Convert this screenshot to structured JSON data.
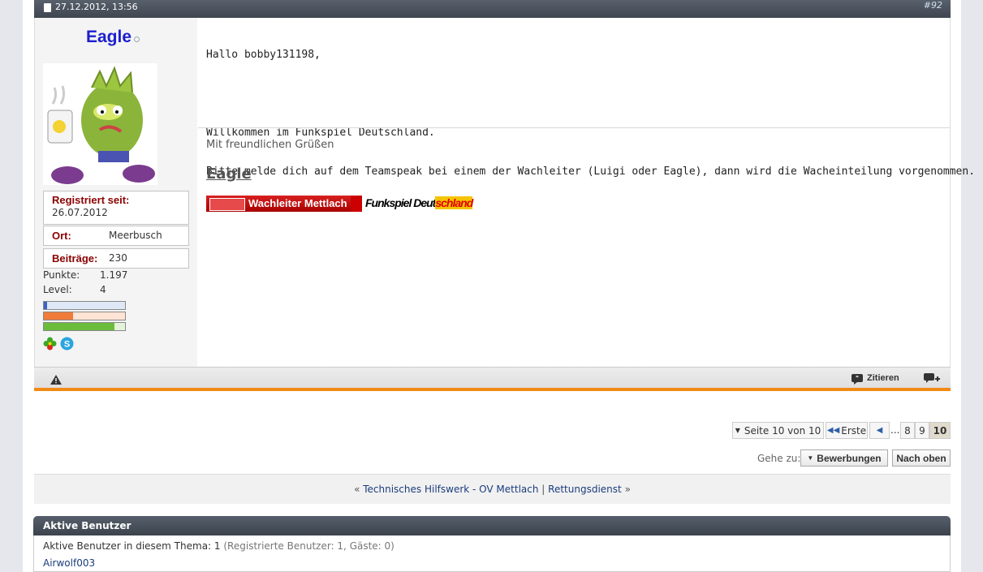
{
  "post": {
    "date": "27.12.2012, 13:56",
    "number": "#92",
    "author": "Eagle",
    "info": {
      "registered_label": "Registriert seit:",
      "registered_value": "26.07.2012",
      "location_label": "Ort:",
      "location_value": "Meerbusch",
      "posts_label": "Beiträge:",
      "posts_value": "230",
      "points_label": "Punkte:",
      "points_value": "1.197",
      "level_label": "Level:",
      "level_value": "4"
    },
    "bars": [
      {
        "fraction": 0.04,
        "color": "#3b63c4",
        "bg": "#dfe8f7"
      },
      {
        "fraction": 0.36,
        "color": "#f07b3a",
        "bg": "#fde4d4"
      },
      {
        "fraction": 0.87,
        "color": "#6cbc3c",
        "bg": "#e4f4da"
      }
    ],
    "message_lines": [
      "Hallo bobby131198,",
      "",
      "Willkommen im Funkspiel Deutschland.",
      "Bitte melde dich auf dem Teamspeak bei einem der Wachleiter (Luigi oder Eagle), dann wird die Wacheinteilung vorgenommen."
    ],
    "signature": {
      "greeting": "Mit freundlichen Grüßen",
      "name": "Eagle",
      "banner_left": "Wachleiter Mettlach",
      "banner_right_a": "Funkspiel Deut",
      "banner_right_b": "schland"
    },
    "footer": {
      "quote_label": "Zitieren"
    }
  },
  "pagination": {
    "page_label": "Seite 10 von 10",
    "first_label": "Erste",
    "ellipsis": "...",
    "pages": [
      "8",
      "9",
      "10"
    ],
    "current": "10"
  },
  "goto": {
    "label": "Gehe zu:",
    "forum": "Bewerbungen",
    "top": "Nach oben"
  },
  "threadnav": {
    "prev_marker": "«",
    "prev": "Technisches Hilfswerk - OV Mettlach",
    "sep": "|",
    "next": "Rettungsdienst",
    "next_marker": "»"
  },
  "active_users": {
    "title": "Aktive Benutzer",
    "line_main": "Aktive Benutzer in diesem Thema: 1",
    "line_detail": "(Registrierte Benutzer: 1, Gäste: 0)",
    "users": [
      "Airwolf003"
    ]
  },
  "colors": {
    "accent_orange": "#f08a14",
    "username_blue": "#1c1fcd",
    "label_red": "#8b0000",
    "link_blue": "#1a3c7c"
  }
}
